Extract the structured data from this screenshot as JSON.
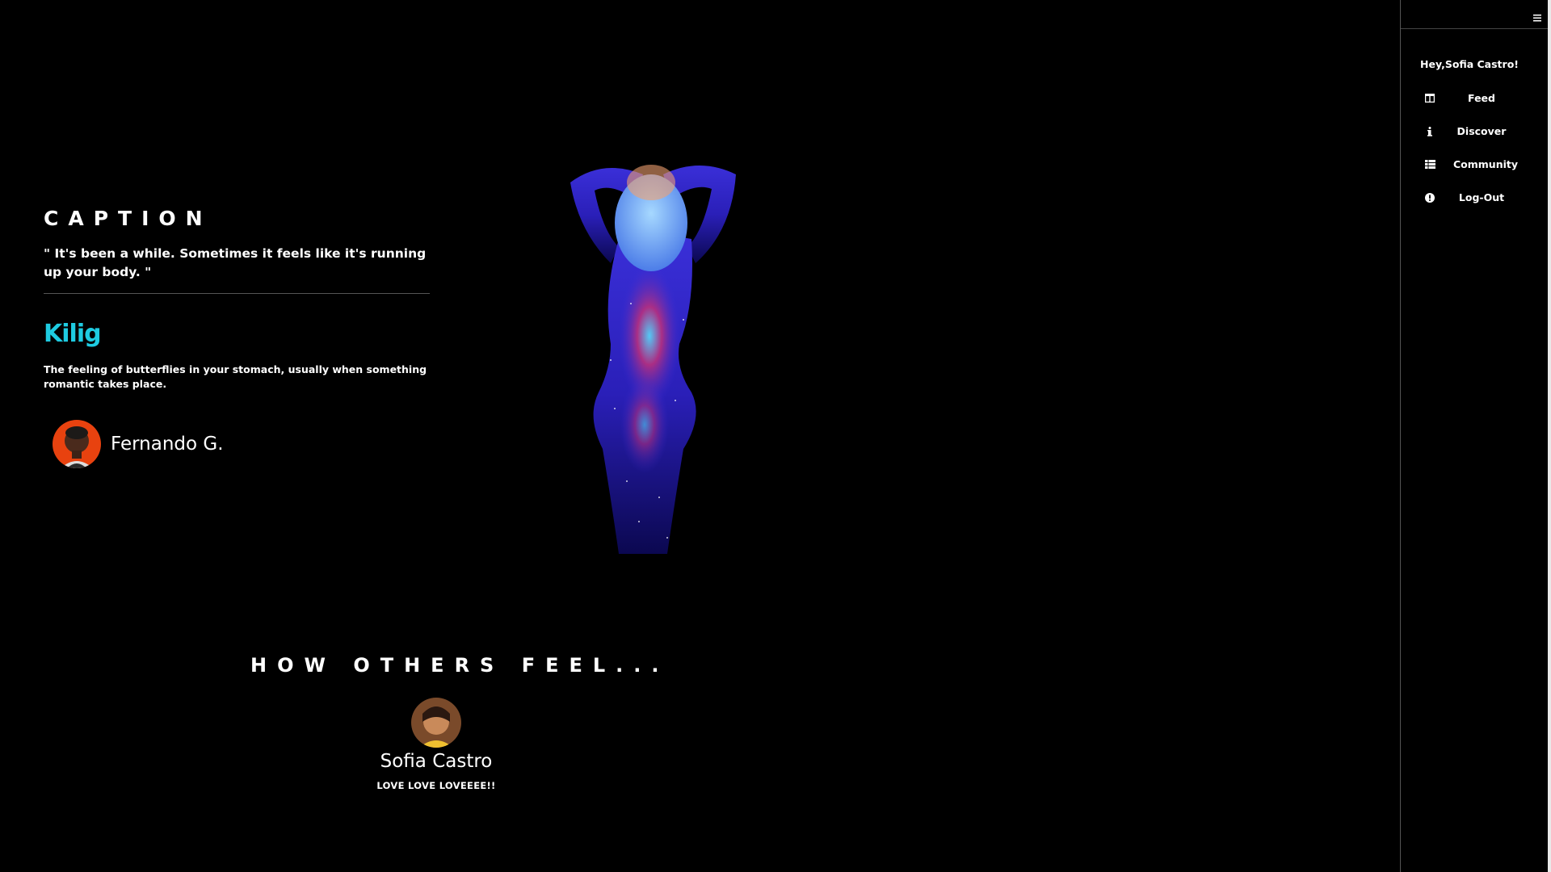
{
  "caption": {
    "heading": "CAPTION",
    "quote": "\" It's been a while. Sometimes it feels like it's running up your body. \""
  },
  "word": {
    "title": "Kilig",
    "definition": "The feeling of butterflies in your stomach, usually when something romantic takes place."
  },
  "author": {
    "name": "Fernando G."
  },
  "others": {
    "heading": "HOW OTHERS FEEL...",
    "comments": [
      {
        "name": "Sofia Castro",
        "comment": "LOVE LOVE LOVEEEE!!"
      }
    ]
  },
  "sidebar": {
    "greeting": "Hey,Sofia Castro!",
    "items": [
      {
        "label": "Feed",
        "icon": "feed-icon"
      },
      {
        "label": "Discover",
        "icon": "info-icon"
      },
      {
        "label": "Community",
        "icon": "grid-icon"
      },
      {
        "label": "Log-Out",
        "icon": "alert-circle-icon"
      }
    ]
  },
  "colors": {
    "background": "#000000",
    "accent": "#1ecbe1",
    "text": "#ffffff"
  }
}
